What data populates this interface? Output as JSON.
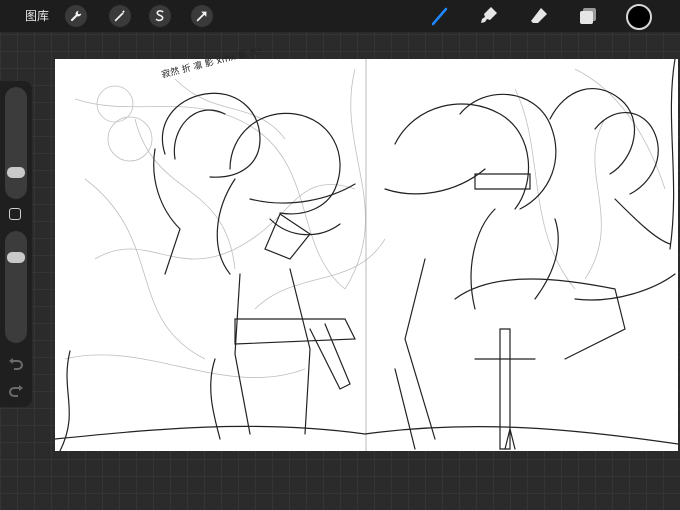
{
  "toolbar": {
    "gallery_label": "图库",
    "left_tools": [
      "wrench-icon",
      "magic-wand-icon",
      "selection-icon",
      "transform-arrow-icon"
    ],
    "right_tools": [
      "brush-icon",
      "smudge-icon",
      "eraser-icon",
      "layers-icon"
    ],
    "active_tool": "brush-icon",
    "accent_color": "#1e88ff",
    "current_color": "#000000"
  },
  "sidebar": {
    "brush_size_level": 0.2,
    "opacity_level": 0.8,
    "modifier_icon": "square-modifier-icon",
    "undo_icon": "undo-icon",
    "redo_icon": "redo-icon"
  },
  "canvas": {
    "caption": "寂然 折 凛 影   xmx   截 光!"
  }
}
